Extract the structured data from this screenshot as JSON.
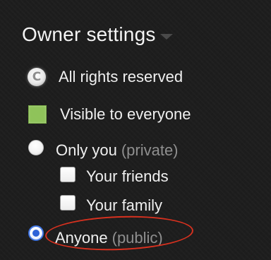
{
  "header": {
    "title": "Owner settings"
  },
  "license": {
    "label": "All rights reserved",
    "icon": "copyright-icon"
  },
  "visibility": {
    "label": "Visible to everyone",
    "icon": "square-icon",
    "color": "#8fc35a"
  },
  "privacy": {
    "only_you": {
      "label": "Only you",
      "note": "(private)",
      "checked": false
    },
    "friends": {
      "label": "Your friends",
      "checked": false
    },
    "family": {
      "label": "Your family",
      "checked": false
    },
    "anyone": {
      "label": "Anyone",
      "note": "(public)",
      "checked": true
    }
  },
  "colors": {
    "background": "#1d1d1d",
    "accent_radio": "#2d62d8",
    "annotation": "#d8311f"
  }
}
